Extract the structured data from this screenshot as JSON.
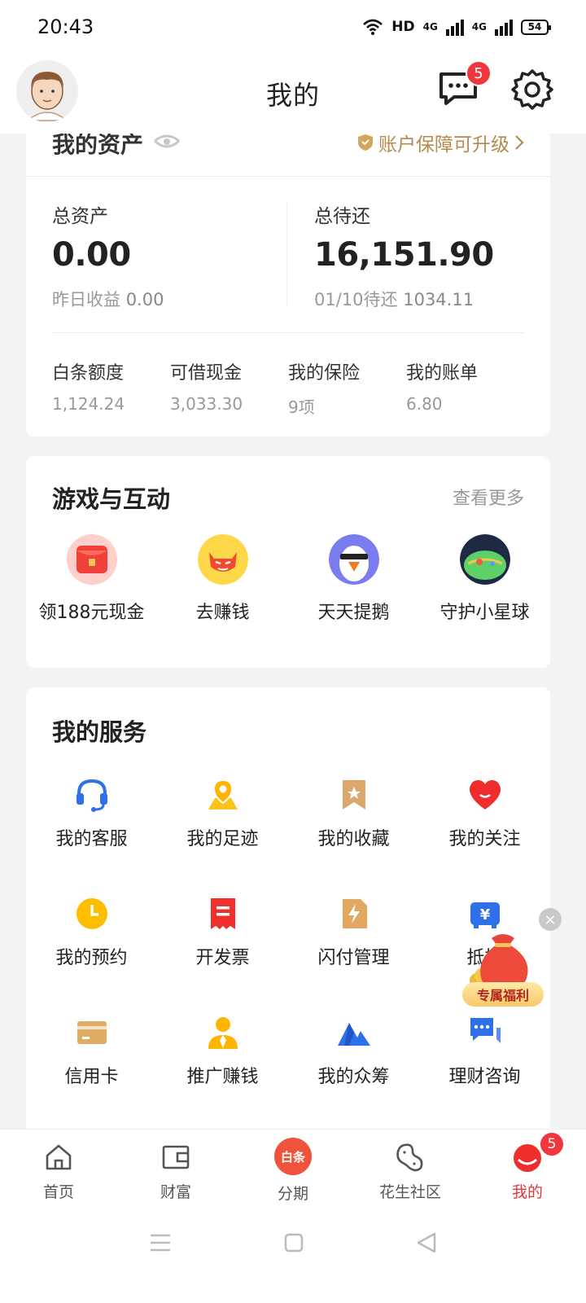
{
  "status_bar": {
    "time": "20:43",
    "network": "HD",
    "signal1": "4G",
    "signal2": "4G",
    "battery": "54"
  },
  "header": {
    "title": "我的",
    "message_badge": "5",
    "icons": [
      "avatar",
      "message-icon",
      "gear-icon"
    ]
  },
  "assets": {
    "title": "我的资产",
    "guarantee": "账户保障可升级",
    "total_assets_label": "总资产",
    "total_assets_value": "0.00",
    "yesterday_label": "昨日收益",
    "yesterday_value": "0.00",
    "total_due_label": "总待还",
    "total_due_value": "16,151.90",
    "due_date_label": "01/10待还",
    "due_date_value": "1034.11",
    "quick": [
      {
        "label": "白条额度",
        "value": "1,124.24"
      },
      {
        "label": "可借现金",
        "value": "3,033.30"
      },
      {
        "label": "我的保险",
        "value": "9项"
      },
      {
        "label": "我的账单",
        "value": "6.80"
      }
    ]
  },
  "games": {
    "title": "游戏与互动",
    "more": "查看更多",
    "items": [
      {
        "label": "领188元现金"
      },
      {
        "label": "去赚钱"
      },
      {
        "label": "天天提鹅"
      },
      {
        "label": "守护小星球"
      }
    ]
  },
  "services": {
    "title": "我的服务",
    "items": [
      {
        "label": "我的客服"
      },
      {
        "label": "我的足迹"
      },
      {
        "label": "我的收藏"
      },
      {
        "label": "我的关注"
      },
      {
        "label": "我的预约"
      },
      {
        "label": "开发票"
      },
      {
        "label": "闪付管理"
      },
      {
        "label": "抵押"
      },
      {
        "label": "信用卡"
      },
      {
        "label": "推广赚钱"
      },
      {
        "label": "我的众筹"
      },
      {
        "label": "理财咨询"
      }
    ]
  },
  "promo": {
    "label": "专属福利",
    "close": "×"
  },
  "tabbar": {
    "items": [
      {
        "label": "首页"
      },
      {
        "label": "财富"
      },
      {
        "label": "分期"
      },
      {
        "label": "花生社区"
      },
      {
        "label": "我的"
      }
    ],
    "installment_icon_text": "白条",
    "me_badge": "5",
    "active_color": "#e5353b"
  }
}
